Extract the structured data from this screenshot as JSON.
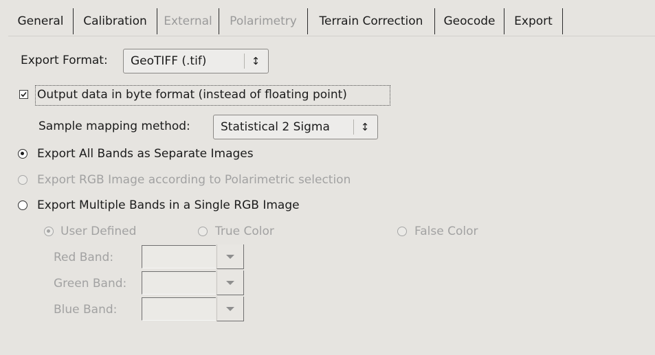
{
  "tabs": [
    {
      "label": "General",
      "state": "normal"
    },
    {
      "label": "Calibration",
      "state": "normal"
    },
    {
      "label": "External",
      "state": "disabled"
    },
    {
      "label": "Polarimetry",
      "state": "disabled"
    },
    {
      "label": "Terrain Correction",
      "state": "normal"
    },
    {
      "label": "Geocode",
      "state": "normal"
    },
    {
      "label": "Export",
      "state": "active"
    }
  ],
  "export_format": {
    "label": "Export Format:",
    "value": "GeoTIFF (.tif)",
    "icon": "updown-arrows-icon"
  },
  "byte_output": {
    "label": "Output data in byte format (instead of floating point)",
    "checked": true
  },
  "sample_mapping": {
    "label": "Sample mapping method:",
    "value": "Statistical 2 Sigma",
    "icon": "updown-arrows-icon"
  },
  "export_options": [
    {
      "label": "Export All Bands as Separate Images",
      "selected": true,
      "enabled": true
    },
    {
      "label": "Export RGB Image according to Polarimetric selection",
      "selected": false,
      "enabled": false
    },
    {
      "label": "Export Multiple Bands in a Single RGB Image",
      "selected": false,
      "enabled": true
    }
  ],
  "color_modes": [
    {
      "label": "User Defined",
      "selected": true,
      "enabled": false
    },
    {
      "label": "True Color",
      "selected": false,
      "enabled": false
    },
    {
      "label": "False Color",
      "selected": false,
      "enabled": false
    }
  ],
  "bands": {
    "red_label": "Red Band:",
    "green_label": "Green Band:",
    "blue_label": "Blue Band:",
    "red_value": "",
    "green_value": "",
    "blue_value": ""
  },
  "colors": {
    "background": "#e6e4e0",
    "text": "#1b1b1b",
    "disabled_text": "#a2a2a2",
    "tab_border": "#2a2a2a"
  }
}
